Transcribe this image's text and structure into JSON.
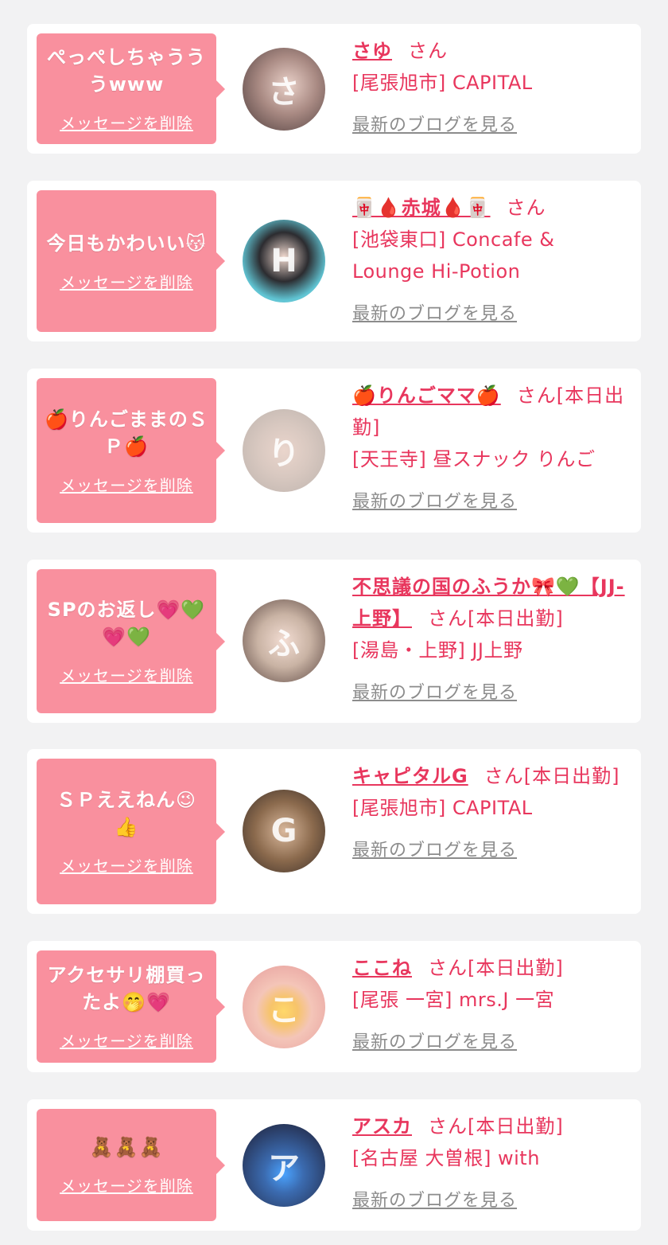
{
  "messages": [
    {
      "bubble_text": "ぺっぺしちゃううう​www",
      "delete_label": "メッセージを削除",
      "avatar_initial": "さ",
      "avatar_color": "#8a6f6a",
      "name": "さゆ",
      "honorific": "さん",
      "shop": "[尾張旭市] CAPITAL",
      "blog_label": "最新のブログを見る"
    },
    {
      "bubble_text": "今日もかわいい😽",
      "delete_label": "メッセージを削除",
      "avatar_initial": "H",
      "avatar_color": "#4fb8c9",
      "name": "🀄🩸赤城🩸🀄",
      "honorific": "さん",
      "shop": "[池袋東口] Concafe & Lounge Hi-Potion",
      "blog_label": "最新のブログを見る"
    },
    {
      "bubble_text": "🍎りんごままのＳＰ🍎",
      "delete_label": "メッセージを削除",
      "avatar_initial": "り",
      "avatar_color": "#d8c8c0",
      "name": "🍎りんごママ🍎",
      "honorific": "さん[本日出勤]",
      "shop": "[天王寺] 昼スナック りんご",
      "blog_label": "最新のブログを見る"
    },
    {
      "bubble_text": "SPのお返し💗💚💗💚",
      "delete_label": "メッセージを削除",
      "avatar_initial": "ふ",
      "avatar_color": "#c9b3a4",
      "name": "不思議の国のふうか🎀💚【JJ-上野】",
      "honorific": "さん[本日出勤]",
      "shop": "[湯島・上野] JJ上野",
      "blog_label": "最新のブログを見る"
    },
    {
      "bubble_text": "ＳＰええねん😉👍",
      "delete_label": "メッセージを削除",
      "avatar_initial": "G",
      "avatar_color": "#8b6a4d",
      "name": "キャピタルG",
      "honorific": "さん[本日出勤]",
      "shop": "[尾張旭市] CAPITAL",
      "blog_label": "最新のブログを見る"
    },
    {
      "bubble_text": "アクセサリ棚買ったよ🤭💗",
      "delete_label": "メッセージを削除",
      "avatar_initial": "こ",
      "avatar_color": "#f4c5b8",
      "name": "ここね",
      "honorific": "さん[本日出勤]",
      "shop": "[尾張 一宮] mrs.J 一宮",
      "blog_label": "最新のブログを見る"
    },
    {
      "bubble_text": "🧸🧸🧸",
      "delete_label": "メッセージを削除",
      "avatar_initial": "ア",
      "avatar_color": "#3b6bb0",
      "name": "アスカ",
      "honorific": "さん[本日出勤]",
      "shop": "[名古屋 大曽根] with",
      "blog_label": "最新のブログを見る"
    }
  ]
}
